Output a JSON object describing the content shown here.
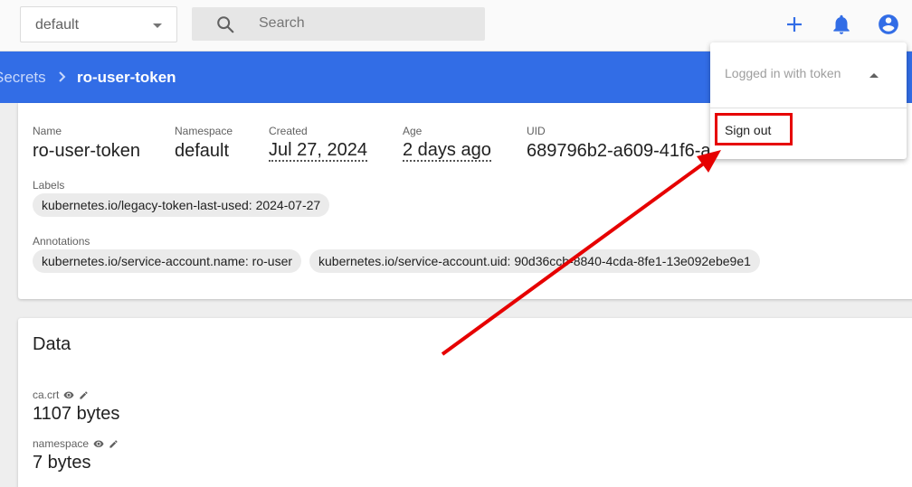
{
  "toolbar": {
    "namespace_value": "default",
    "search_placeholder": "Search"
  },
  "breadcrumb": {
    "parent": "Secrets",
    "current": "ro-user-token"
  },
  "metadata": {
    "name_label": "Name",
    "name_value": "ro-user-token",
    "namespace_label": "Namespace",
    "namespace_value": "default",
    "created_label": "Created",
    "created_value": "Jul 27, 2024",
    "age_label": "Age",
    "age_value": "2 days ago",
    "uid_label": "UID",
    "uid_value": "689796b2-a609-41f6-a",
    "labels_label": "Labels",
    "labels": [
      "kubernetes.io/legacy-token-last-used: 2024-07-27"
    ],
    "annotations_label": "Annotations",
    "annotations": [
      "kubernetes.io/service-account.name: ro-user",
      "kubernetes.io/service-account.uid: 90d36ccb-8840-4cda-8fe1-13e092ebe9e1"
    ]
  },
  "data_section": {
    "title": "Data",
    "items": [
      {
        "key": "ca.crt",
        "value": "1107 bytes"
      },
      {
        "key": "namespace",
        "value": "7 bytes"
      }
    ]
  },
  "user_menu": {
    "status": "Logged in with token",
    "sign_out": "Sign out"
  },
  "icons": {
    "search": "search-icon",
    "add": "add-icon",
    "notifications": "bell-icon",
    "account": "account-circle-icon",
    "view": "eye-icon",
    "edit": "pencil-icon"
  },
  "colors": {
    "brand_blue": "#326de6",
    "annotation_red": "#e60000"
  }
}
